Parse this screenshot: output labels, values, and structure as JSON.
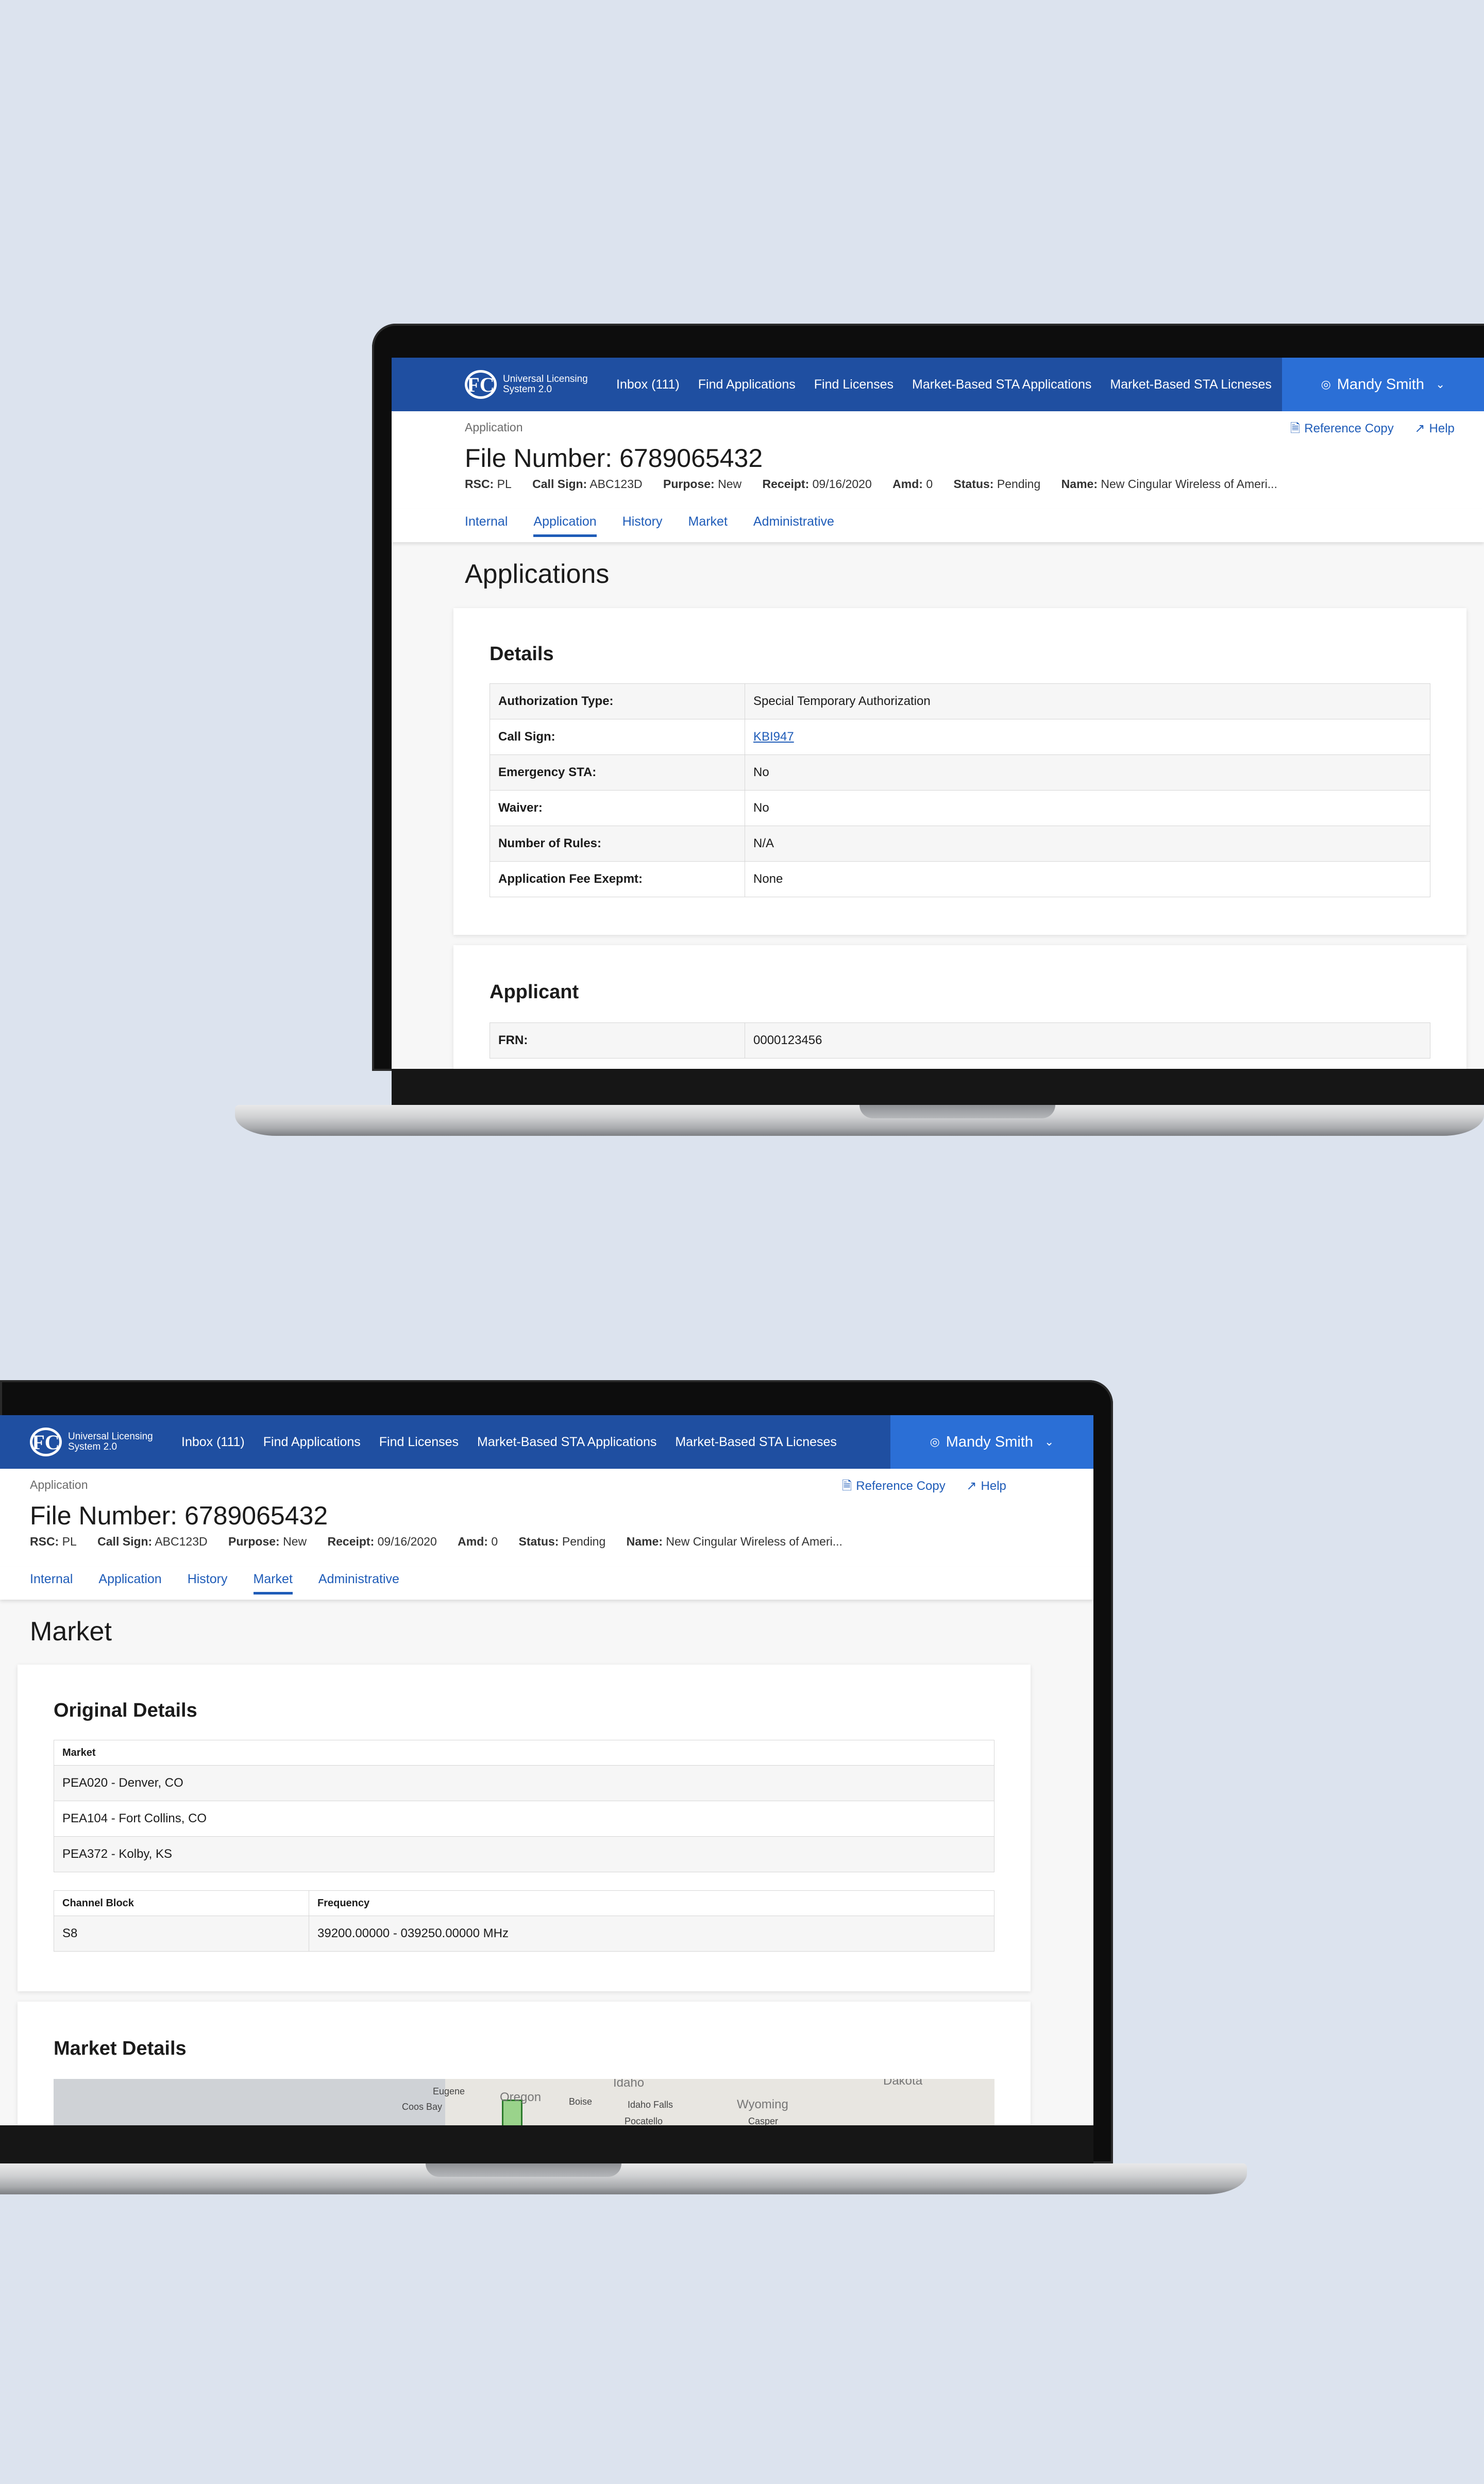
{
  "header": {
    "logo_text": "Universal Licensing System 2.0",
    "nav": [
      "Inbox (111)",
      "Find Applications",
      "Find Licenses",
      "Market-Based STA Applications",
      "Market-Based STA Licneses"
    ],
    "user": "Mandy Smith"
  },
  "subheader": {
    "breadcrumb": "Application",
    "reference_copy": "Reference Copy",
    "help": "Help",
    "file_number": "File Number: 6789065432",
    "meta": [
      {
        "label": "RSC:",
        "value": "PL"
      },
      {
        "label": "Call Sign:",
        "value": "ABC123D"
      },
      {
        "label": "Purpose:",
        "value": "New"
      },
      {
        "label": "Receipt:",
        "value": "09/16/2020"
      },
      {
        "label": "Amd:",
        "value": "0"
      },
      {
        "label": "Status:",
        "value": "Pending"
      },
      {
        "label": "Name:",
        "value": "New Cingular Wireless of Ameri..."
      }
    ],
    "tabs": [
      "Internal",
      "Application",
      "History",
      "Market",
      "Administrative"
    ]
  },
  "screen1": {
    "active_tab": "Application",
    "title": "Applications",
    "details": {
      "heading": "Details",
      "rows": [
        {
          "label": "Authorization Type:",
          "value": "Special Temporary Authorization"
        },
        {
          "label": "Call Sign:",
          "value": "KBI947"
        },
        {
          "label": "Emergency STA:",
          "value": "No"
        },
        {
          "label": "Waiver:",
          "value": "No"
        },
        {
          "label": "Number of Rules:",
          "value": "N/A"
        },
        {
          "label": "Application Fee Exepmt:",
          "value": "None"
        }
      ]
    },
    "applicant": {
      "heading": "Applicant",
      "rows": [
        {
          "label": "FRN:",
          "value": "0000123456"
        }
      ]
    }
  },
  "screen2": {
    "active_tab": "Market",
    "title": "Market",
    "original_details": {
      "heading": "Original Details",
      "market_header": "Market",
      "markets": [
        "PEA020 - Denver, CO",
        "PEA104 - Fort Collins, CO",
        "PEA372 - Kolby, KS"
      ],
      "channel_header": "Channel Block",
      "frequency_header": "Frequency",
      "channel_rows": [
        {
          "block": "S8",
          "frequency": "39200.00000 - 039250.00000  MHz"
        }
      ]
    },
    "market_details": {
      "heading": "Market Details",
      "map_labels": [
        "Eugene",
        "Oregon",
        "Coos Bay",
        "Boise",
        "Idaho",
        "Idaho Falls",
        "Pocatello",
        "Wyoming",
        "Casper",
        "Dakota"
      ]
    }
  },
  "colors": {
    "header_blue": "#1f4fa1",
    "user_blue": "#2b6fd6",
    "link_blue": "#1f5cb8",
    "background": "#dce3ee"
  }
}
